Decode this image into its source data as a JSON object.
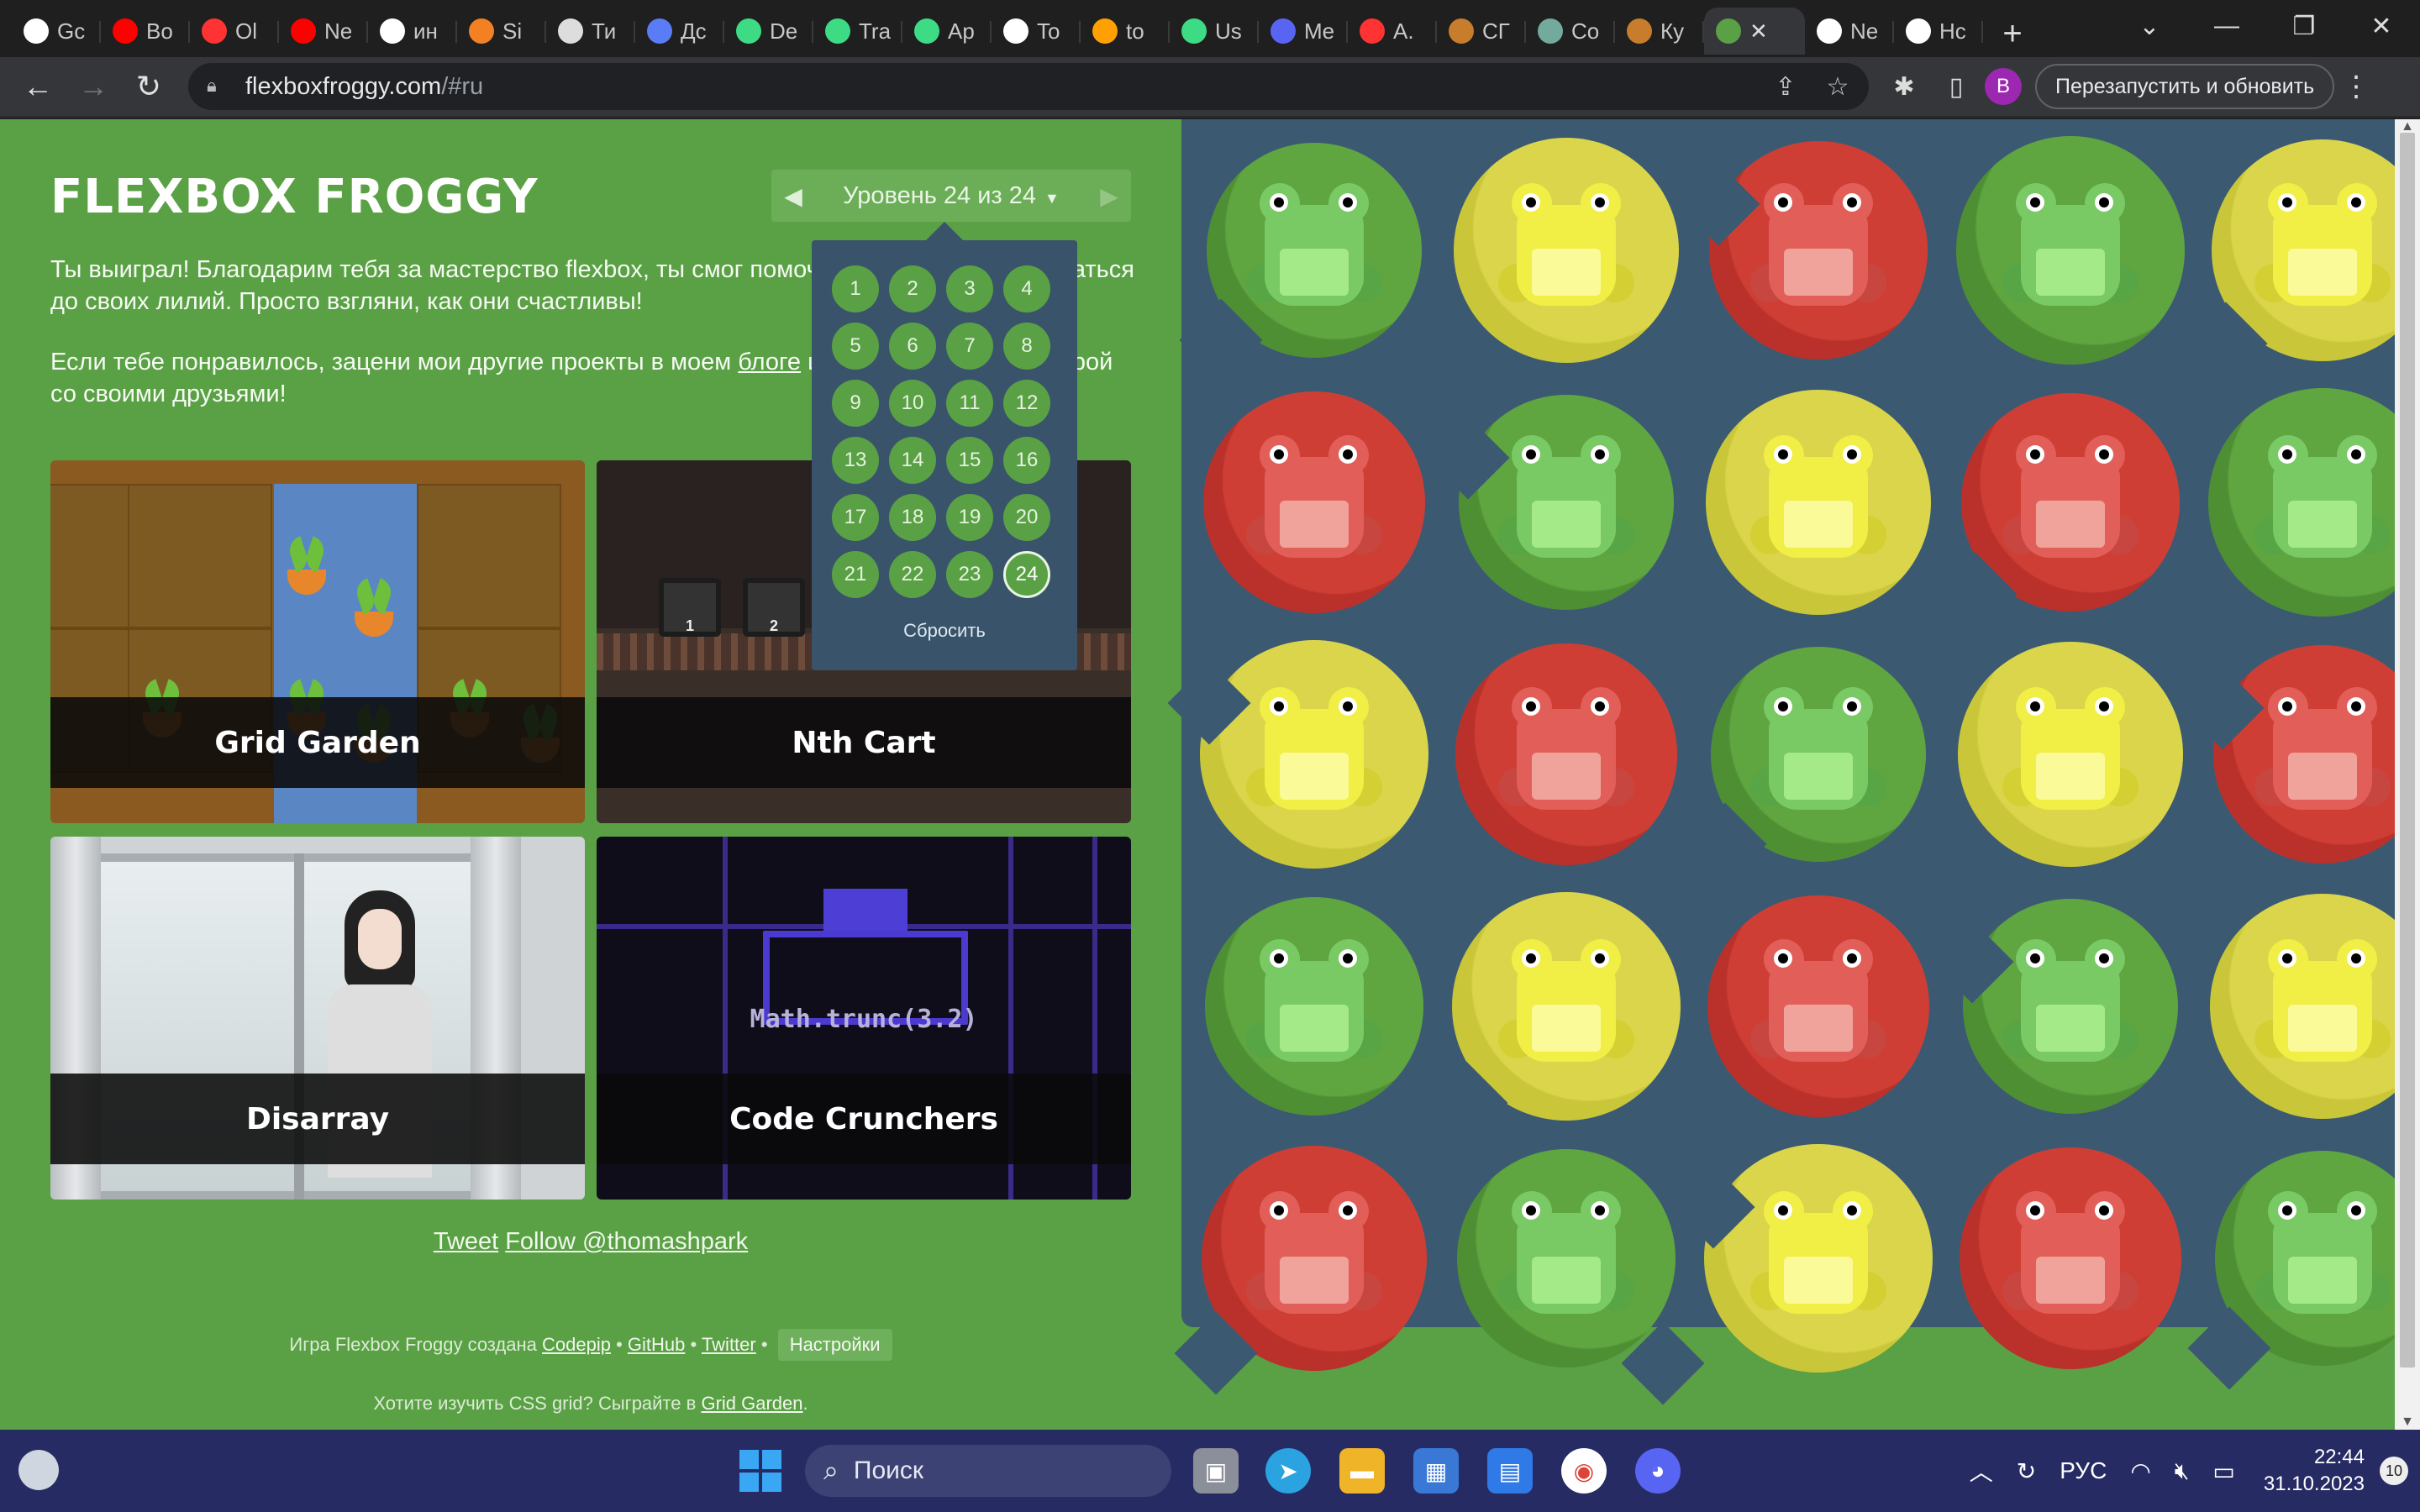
{
  "browser": {
    "tabs": [
      {
        "short": "Gc",
        "icon": "google-icon",
        "color": "#ffffff"
      },
      {
        "short": "Bo",
        "icon": "youtube-icon",
        "color": "#ff0000"
      },
      {
        "short": "Ol",
        "icon": "yandex-icon",
        "color": "#ff3333"
      },
      {
        "short": "Ne",
        "icon": "youtube-icon",
        "color": "#ff0000"
      },
      {
        "short": "ин",
        "icon": "notion-icon",
        "color": "#ffffff"
      },
      {
        "short": "Si",
        "icon": "stack-icon",
        "color": "#f48024"
      },
      {
        "short": "Ти",
        "icon": "shield-icon",
        "color": "#dddddd"
      },
      {
        "short": "Дс",
        "icon": "app-icon",
        "color": "#5b7cf7"
      },
      {
        "short": "De",
        "icon": "android-icon",
        "color": "#3ddc84"
      },
      {
        "short": "Tra",
        "icon": "android-icon",
        "color": "#3ddc84"
      },
      {
        "short": "Ap",
        "icon": "android-icon",
        "color": "#3ddc84"
      },
      {
        "short": "To",
        "icon": "github-icon",
        "color": "#ffffff"
      },
      {
        "short": "to",
        "icon": "firebase-icon",
        "color": "#ffa000"
      },
      {
        "short": "Us",
        "icon": "android-icon",
        "color": "#3ddc84"
      },
      {
        "short": "Me",
        "icon": "chat-icon",
        "color": "#5865f2"
      },
      {
        "short": "A.",
        "icon": "yandex-icon",
        "color": "#ff3333"
      },
      {
        "short": "СГ",
        "icon": "m-icon",
        "color": "#c77d2b"
      },
      {
        "short": "Co",
        "icon": "openai-icon",
        "color": "#74aa9c"
      },
      {
        "short": "Ку",
        "icon": "m-icon",
        "color": "#c77d2b"
      },
      {
        "short": "",
        "icon": "frog-icon",
        "color": "#5aa145",
        "active": true
      },
      {
        "short": "Ne",
        "icon": "github-icon",
        "color": "#ffffff"
      },
      {
        "short": "Hc",
        "icon": "chrome-icon",
        "color": "#ffffff"
      }
    ],
    "url_host": "flexboxfroggy.com",
    "url_path": "/#ru",
    "profile_initial": "B",
    "relaunch_label": "Перезапустить и обновить"
  },
  "game": {
    "logo": "FLEXBOX FROGGY",
    "level_indicator": "Уровень 24 из 24",
    "intro_p1": "Ты выиграл! Благодарим тебя за мастерство flexbox, ты смог помочь всем лягушкам добраться до своих лилий. Просто взгляни, как они счастливы!",
    "intro_p2_before": "Если тебе понравилось, зацени мои другие проекты в моем",
    "intro_p2_link": "блоге",
    "intro_p2_after": "или поделиться этой игрой со своими друзьями!",
    "cards": [
      {
        "title": "Grid Garden"
      },
      {
        "title": "Nth Cart"
      },
      {
        "title": "Disarray"
      },
      {
        "title": "Code Crunchers"
      }
    ],
    "nth_cart_numbers": [
      "1",
      "2"
    ],
    "code_crunchers_code": "Math.trunc(3.2)",
    "tweet_label": "Tweet",
    "follow_label": "Follow @thomashpark",
    "credits_prefix": "Игра Flexbox Froggy создана",
    "credits_links": [
      "Codepip",
      "GitHub",
      "Twitter"
    ],
    "credits_sep": "•",
    "settings_label": "Настройки",
    "tagline_prefix": "Хотите изучить CSS grid? Сыграйте в",
    "tagline_link": "Grid Garden",
    "tagline_suffix": "."
  },
  "level_menu": {
    "levels": [
      "1",
      "2",
      "3",
      "4",
      "5",
      "6",
      "7",
      "8",
      "9",
      "10",
      "11",
      "12",
      "13",
      "14",
      "15",
      "16",
      "17",
      "18",
      "19",
      "20",
      "21",
      "22",
      "23",
      "24"
    ],
    "current": "24",
    "reset_label": "Сбросить"
  },
  "board": {
    "grid": [
      [
        "green",
        "yellow",
        "red",
        "green",
        "yellow"
      ],
      [
        "red",
        "green",
        "yellow",
        "red",
        "green"
      ],
      [
        "yellow",
        "red",
        "green",
        "yellow",
        "red"
      ],
      [
        "green",
        "yellow",
        "red",
        "green",
        "yellow"
      ],
      [
        "red",
        "green",
        "yellow",
        "red",
        "green"
      ]
    ],
    "colors": {
      "green": {
        "pad": "#4e8f34",
        "padEdge": "#5fa540",
        "frog": "#79c965",
        "belly": "#a5ea88",
        "dark": "#58a545"
      },
      "yellow": {
        "pad": "#c9c63a",
        "padEdge": "#dad54a",
        "frog": "#f1ee46",
        "belly": "#fbfa99",
        "dark": "#d4d033"
      },
      "red": {
        "pad": "#b9312a",
        "padEdge": "#cf3e35",
        "frog": "#e15f58",
        "belly": "#f0a39a",
        "dark": "#c84640"
      }
    }
  },
  "taskbar": {
    "search_label": "Поиск",
    "lang": "РУС",
    "time": "22:44",
    "date": "31.10.2023",
    "notifications": "10"
  }
}
